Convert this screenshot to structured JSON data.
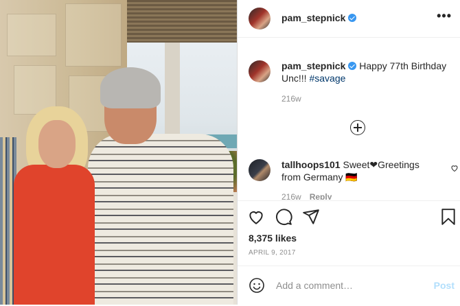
{
  "post": {
    "username": "pam_stepnick",
    "caption_text": "Happy 77th Birthday Unc!!!",
    "caption_tag": "#savage",
    "caption_age": "216w",
    "likes": "8,375 likes",
    "date": "April 9, 2017"
  },
  "comments": [
    {
      "username": "tallhoops101",
      "text": "Sweet❤Greetings from Germany 🇩🇪",
      "age": "216w",
      "reply_label": "Reply"
    }
  ],
  "composer": {
    "placeholder": "Add a comment…",
    "post_label": "Post"
  },
  "colors": {
    "link": "#00376b",
    "verified": "#3897f0",
    "post_button_disabled": "#b2dffc",
    "muted": "#8e8e8e"
  },
  "icons": [
    "more-options-icon",
    "verified-badge-icon",
    "load-more-icon",
    "comment-like-icon",
    "heart-icon",
    "comment-icon",
    "share-icon",
    "bookmark-icon",
    "emoji-icon"
  ]
}
